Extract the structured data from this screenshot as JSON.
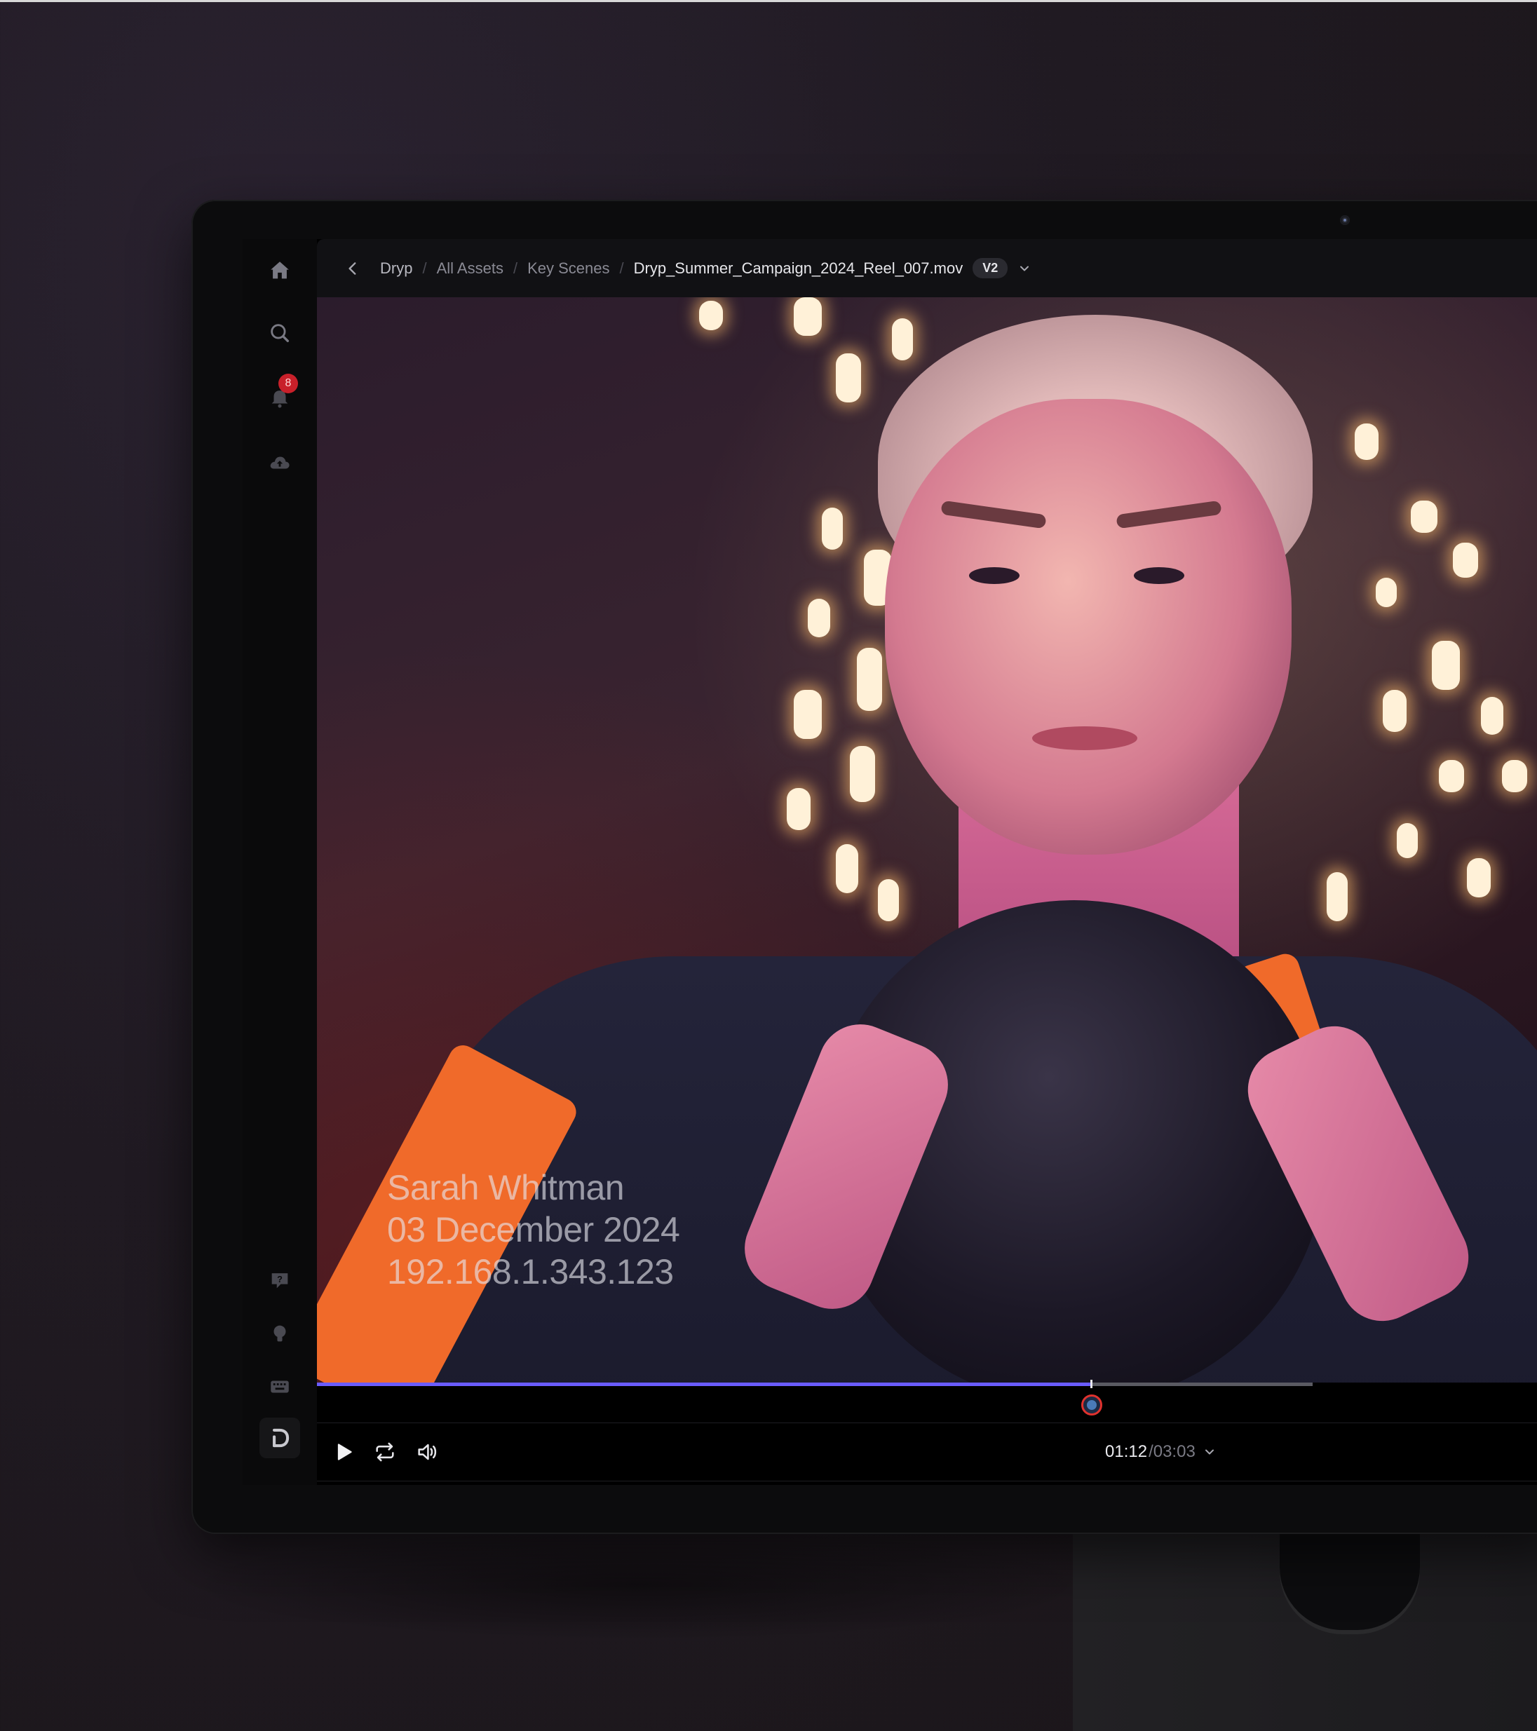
{
  "breadcrumb": {
    "back_icon": "chevron-left-icon",
    "items": [
      "Dryp",
      "All Assets",
      "Key Scenes"
    ],
    "separator": "/",
    "current_file": "Dryp_Summer_Campaign_2024_Reel_007.mov",
    "version": "V2"
  },
  "sidebar": {
    "top_icons": [
      "home-icon",
      "search-icon",
      "bell-icon",
      "cloud-upload-icon"
    ],
    "notification_count": "8",
    "bottom_icons": [
      "help-icon",
      "lightbulb-icon",
      "keyboard-icon",
      "dryp-logo-icon"
    ]
  },
  "watermark": {
    "name": "Sarah Whitman",
    "date": "03 December 2024",
    "ip": "192.168.1.343.123"
  },
  "player": {
    "current_time": "01:12",
    "total_time": "/03:03",
    "progress": 0.393,
    "buffered": 0.46
  },
  "colors": {
    "accent": "#6a5cff",
    "badge": "#c8202a",
    "marker_ring": "#e0322e"
  }
}
